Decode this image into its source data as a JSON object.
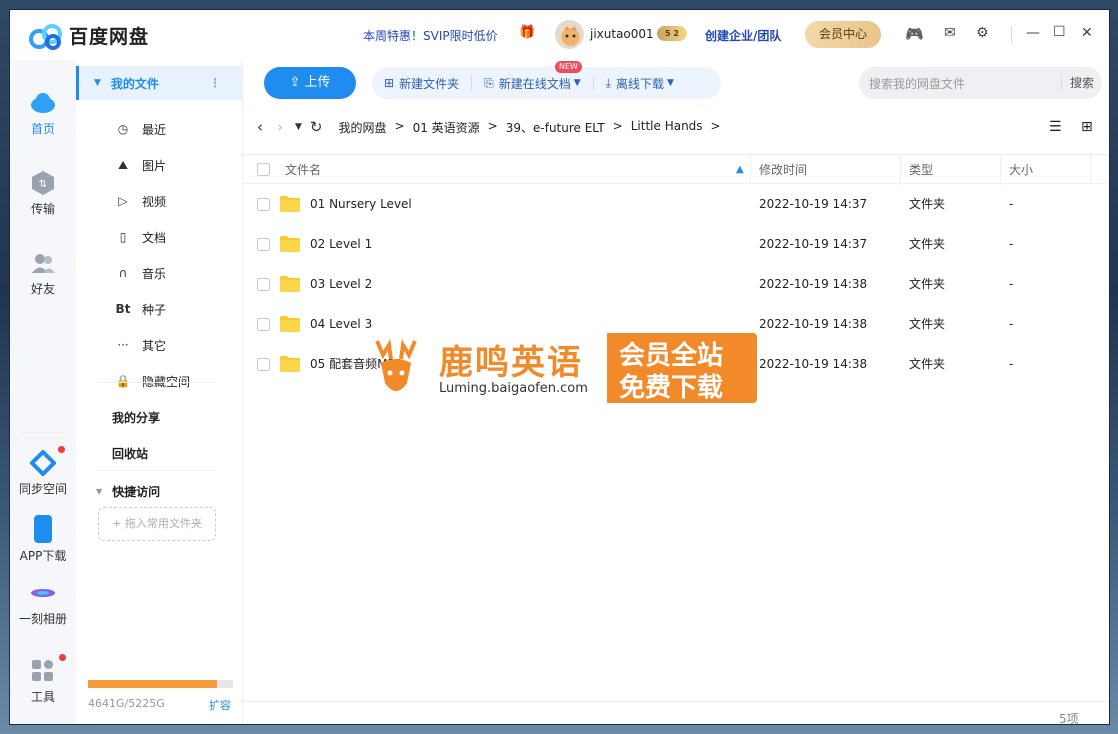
{
  "titlebar": {
    "app_name": "百度网盘",
    "promo": "本周特惠！SVIP限时低价",
    "username": "jixutao001",
    "vip_level": "5 2",
    "enterprise": "创建企业/团队",
    "member_center": "会员中心"
  },
  "nav": {
    "items": [
      {
        "label": "首页"
      },
      {
        "label": "传输"
      },
      {
        "label": "好友"
      },
      {
        "label": "同步空间"
      },
      {
        "label": "APP下载"
      },
      {
        "label": "一刻相册"
      },
      {
        "label": "工具"
      }
    ]
  },
  "sidebar": {
    "my_files": "我的文件",
    "items": [
      {
        "label": "最近",
        "icon": "clock-icon",
        "glyph": "◷"
      },
      {
        "label": "图片",
        "icon": "image-icon",
        "glyph": "⛰"
      },
      {
        "label": "视频",
        "icon": "play-icon",
        "glyph": "▷"
      },
      {
        "label": "文档",
        "icon": "document-icon",
        "glyph": "▯"
      },
      {
        "label": "音乐",
        "icon": "headphones-icon",
        "glyph": "∩"
      },
      {
        "label": "种子",
        "icon": "bt-icon",
        "glyph": "Bt"
      },
      {
        "label": "其它",
        "icon": "more-icon",
        "glyph": "···"
      },
      {
        "label": "隐藏空间",
        "icon": "lock-icon",
        "glyph": "🔒"
      }
    ],
    "my_share": "我的分享",
    "recycle": "回收站",
    "quick_access": "快捷访问",
    "drop_hint": "+ 拖入常用文件夹",
    "storage_text": "4641G/5225G",
    "storage_used": 4641,
    "storage_total": 5225,
    "expand": "扩容"
  },
  "toolbar": {
    "upload": "上传",
    "new_folder": "新建文件夹",
    "new_doc": "新建在线文档",
    "new_badge": "NEW",
    "offline": "离线下载",
    "search_placeholder": "搜索我的网盘文件",
    "search_btn": "搜索"
  },
  "breadcrumb": [
    "我的网盘",
    "01 英语资源",
    "39、e-future ELT",
    "Little Hands"
  ],
  "table": {
    "headers": {
      "name": "文件名",
      "modified": "修改时间",
      "type": "类型",
      "size": "大小"
    },
    "rows": [
      {
        "name": "01 Nursery Level",
        "modified": "2022-10-19 14:37",
        "type": "文件夹",
        "size": "-"
      },
      {
        "name": "02 Level 1",
        "modified": "2022-10-19 14:37",
        "type": "文件夹",
        "size": "-"
      },
      {
        "name": "03 Level 2",
        "modified": "2022-10-19 14:38",
        "type": "文件夹",
        "size": "-"
      },
      {
        "name": "04 Level 3",
        "modified": "2022-10-19 14:38",
        "type": "文件夹",
        "size": "-"
      },
      {
        "name": "05 配套音频MP3",
        "modified": "2022-10-19 14:38",
        "type": "文件夹",
        "size": "-"
      }
    ]
  },
  "status": {
    "count": "5项"
  },
  "watermark": {
    "title": "鹿鸣英语",
    "url": "Luming.baigaofen.com",
    "line1": "会员全站",
    "line2": "免费下载"
  },
  "colors": {
    "accent": "#1f8cf0",
    "storage": "#f59b3c",
    "watermark": "#f28a2a",
    "folder": "#f9c933"
  }
}
